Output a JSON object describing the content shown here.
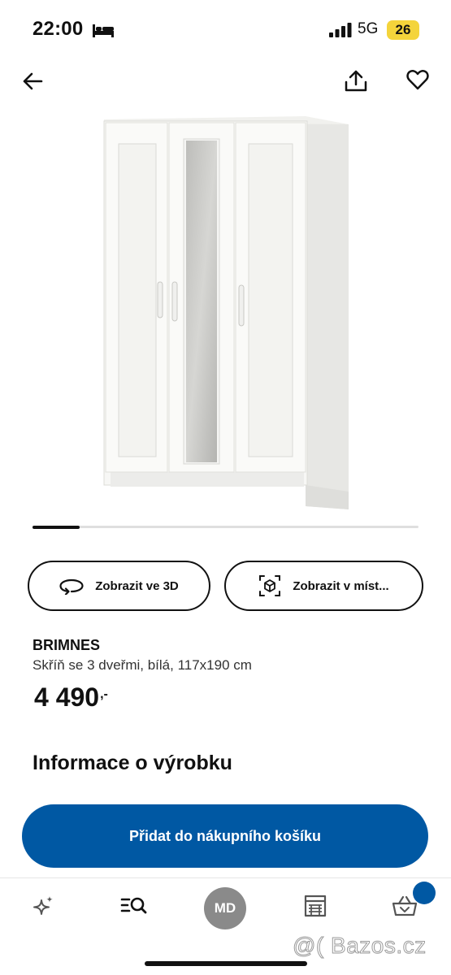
{
  "status_bar": {
    "time": "22:00",
    "network": "5G",
    "battery": "26"
  },
  "icons": {
    "back": "arrow-left-icon",
    "share": "share-icon",
    "favorite": "heart-icon",
    "view_3d": "rotate-3d-icon",
    "view_in_room": "ar-cube-icon",
    "nav": [
      "sparkle-icon",
      "search-list-icon",
      "avatar",
      "store-icon",
      "basket-icon"
    ]
  },
  "actions": {
    "view_3d_label": "Zobrazit ve 3D",
    "view_in_room_label": "Zobrazit v míst..."
  },
  "product": {
    "name": "BRIMNES",
    "description": "Skříň se 3 dveřmi, bílá, 117x190 cm",
    "price": "4 490",
    "price_suffix": ",-"
  },
  "sections": {
    "info_heading": "Informace o výrobku"
  },
  "cart": {
    "button_label": "Přidat do nákupního košíku"
  },
  "bottom_nav": {
    "avatar_initials": "MD"
  },
  "carousel": {
    "current_index": 1,
    "progress": 0.12
  },
  "watermark": "@( Bazos.cz",
  "colors": {
    "brand_blue": "#0058a3",
    "battery_yellow": "#f4d43b",
    "avatar_gray": "#8a8a8a"
  }
}
